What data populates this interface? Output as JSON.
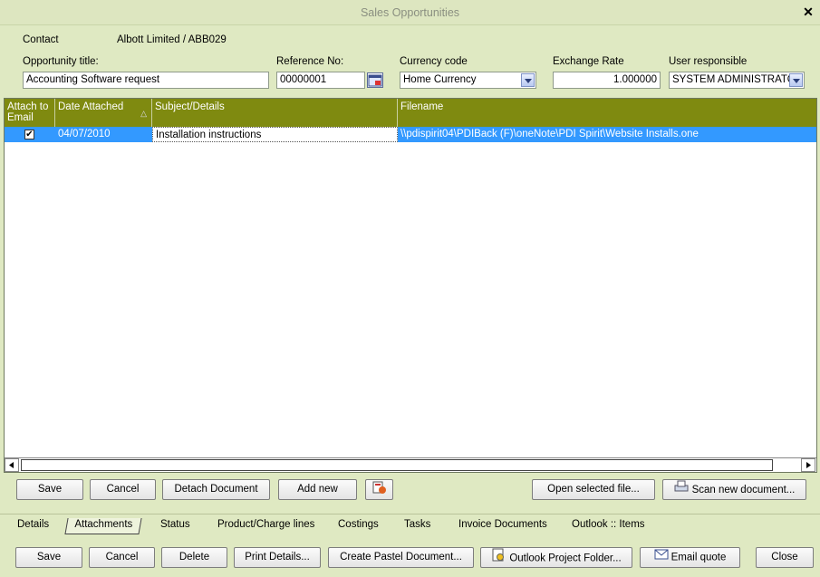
{
  "window": {
    "title": "Sales Opportunities"
  },
  "contact": {
    "label": "Contact",
    "value": "Albott Limited / ABB029"
  },
  "opportunity_title": {
    "label": "Opportunity title:",
    "value": "Accounting Software request"
  },
  "reference": {
    "label": "Reference No:",
    "value": "00000001"
  },
  "currency": {
    "label": "Currency code",
    "value": "Home Currency"
  },
  "exchange": {
    "label": "Exchange Rate",
    "value": "1.000000"
  },
  "user": {
    "label": "User responsible",
    "value": "SYSTEM ADMINISTRATOR"
  },
  "grid": {
    "columns": [
      "Attach to Email",
      "Date Attached",
      "Subject/Details",
      "Filename"
    ],
    "rows": [
      {
        "attach": true,
        "date": "04/07/2010",
        "subject": "Installation instructions",
        "filename": "\\\\pdispirit04\\PDIBack (F)\\oneNote\\PDI Spirit\\Website Installs.one"
      }
    ]
  },
  "grid_buttons": {
    "save": "Save",
    "cancel": "Cancel",
    "detach": "Detach Document",
    "add_new": "Add new",
    "open_file": "Open selected file...",
    "scan": "Scan new document..."
  },
  "tabs": [
    "Details",
    "Attachments",
    "Status",
    "Product/Charge lines",
    "Costings",
    "Tasks",
    "Invoice Documents",
    "Outlook :: Items"
  ],
  "bottom_buttons": {
    "save": "Save",
    "cancel": "Cancel",
    "delete": "Delete",
    "print": "Print Details...",
    "pastel": "Create Pastel Document...",
    "outlook_folder": "Outlook Project Folder...",
    "email": "Email quote",
    "close": "Close"
  }
}
